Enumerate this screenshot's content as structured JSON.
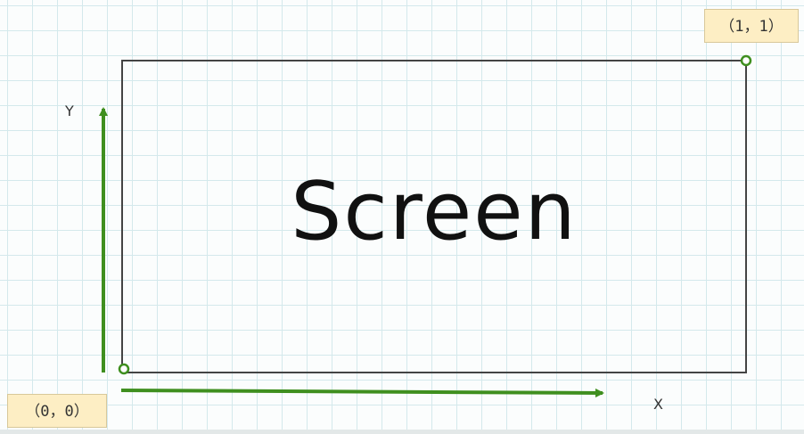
{
  "diagram": {
    "screen_label": "Screen",
    "y_axis_label": "Y",
    "x_axis_label": "X",
    "origin_label": "（0，0）",
    "corner_label": "（1，1）",
    "colors": {
      "axis_arrow": "#3f8f1f",
      "screen_border": "#444444",
      "label_background": "#fdeec4",
      "grid_line": "#d4e9ec"
    }
  }
}
